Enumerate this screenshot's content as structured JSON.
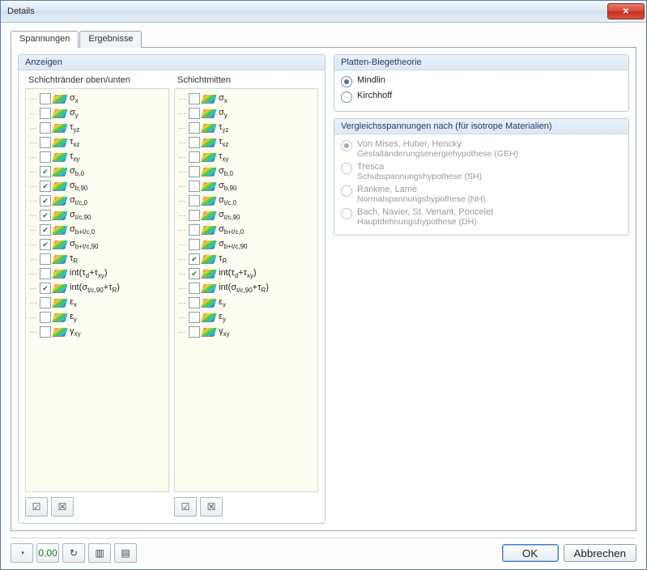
{
  "window": {
    "title": "Details"
  },
  "tabs": [
    {
      "label": "Spannungen",
      "active": true
    },
    {
      "label": "Ergebnisse",
      "active": false
    }
  ],
  "anzeigen": {
    "title": "Anzeigen",
    "col1_header": "Schichtränder oben/unten",
    "col2_header": "Schichtmitten",
    "items_col1": [
      {
        "label": "σ<sub>x</sub>",
        "checked": false
      },
      {
        "label": "σ<sub>y</sub>",
        "checked": false
      },
      {
        "label": "τ<sub>yz</sub>",
        "checked": false
      },
      {
        "label": "τ<sub>xz</sub>",
        "checked": false
      },
      {
        "label": "τ<sub>xy</sub>",
        "checked": false
      },
      {
        "label": "σ<sub>b,0</sub>",
        "checked": true
      },
      {
        "label": "σ<sub>b,90</sub>",
        "checked": true
      },
      {
        "label": "σ<sub>t/c,0</sub>",
        "checked": true
      },
      {
        "label": "σ<sub>t/c,90</sub>",
        "checked": true
      },
      {
        "label": "σ<sub>b+t/c,0</sub>",
        "checked": true
      },
      {
        "label": "σ<sub>b+t/c,90</sub>",
        "checked": true
      },
      {
        "label": "τ<sub>R</sub>",
        "checked": false
      },
      {
        "label": "int(τ<sub>d</sub>+τ<sub>xy</sub>)",
        "checked": false
      },
      {
        "label": "int(σ<sub>t/c,90</sub>+τ<sub>R</sub>)",
        "checked": true
      },
      {
        "label": "ε<sub>x</sub>",
        "checked": false
      },
      {
        "label": "ε<sub>y</sub>",
        "checked": false
      },
      {
        "label": "γ<sub>xy</sub>",
        "checked": false
      }
    ],
    "items_col2": [
      {
        "label": "σ<sub>x</sub>",
        "checked": false
      },
      {
        "label": "σ<sub>y</sub>",
        "checked": false
      },
      {
        "label": "τ<sub>yz</sub>",
        "checked": false
      },
      {
        "label": "τ<sub>xz</sub>",
        "checked": false
      },
      {
        "label": "τ<sub>xy</sub>",
        "checked": false
      },
      {
        "label": "σ<sub>b,0</sub>",
        "checked": false
      },
      {
        "label": "σ<sub>b,90</sub>",
        "checked": false
      },
      {
        "label": "σ<sub>t/c,0</sub>",
        "checked": false
      },
      {
        "label": "σ<sub>t/c,90</sub>",
        "checked": false
      },
      {
        "label": "σ<sub>b+t/c,0</sub>",
        "checked": false
      },
      {
        "label": "σ<sub>b+t/c,90</sub>",
        "checked": false
      },
      {
        "label": "τ<sub>R</sub>",
        "checked": true
      },
      {
        "label": "int(τ<sub>d</sub>+τ<sub>xy</sub>)",
        "checked": true
      },
      {
        "label": "int(σ<sub>t/c,90</sub>+τ<sub>R</sub>)",
        "checked": false
      },
      {
        "label": "ε<sub>x</sub>",
        "checked": false
      },
      {
        "label": "ε<sub>y</sub>",
        "checked": false
      },
      {
        "label": "γ<sub>xy</sub>",
        "checked": false
      }
    ],
    "toolbar": {
      "select_all": "Alle auswählen",
      "select_none": "Keine auswählen"
    }
  },
  "platten": {
    "title": "Platten-Biegetheorie",
    "options": [
      {
        "label": "Mindlin",
        "selected": true
      },
      {
        "label": "Kirchhoff",
        "selected": false
      }
    ]
  },
  "vergleich": {
    "title": "Vergleichsspannungen nach (für isotrope Materialien)",
    "options": [
      {
        "label": "Von Mises, Huber, Hencky",
        "sub": "Gestaltänderungsenergiehypothese (GEH)",
        "selected": true
      },
      {
        "label": "Tresca",
        "sub": "Schubspannungshypothese (SH)",
        "selected": false
      },
      {
        "label": "Rankine, Lamé",
        "sub": "Normalspannungshypothese (NH)",
        "selected": false
      },
      {
        "label": "Bach, Navier, St. Venant, Poncelet",
        "sub": "Hauptdehnungshypothese (DH)",
        "selected": false
      }
    ]
  },
  "bottom_toolbar": {
    "icon1": "help-icon",
    "icon2": "decimals-icon",
    "icon3": "units-icon",
    "icon4": "export-icon",
    "icon5": "layout-icon"
  },
  "buttons": {
    "ok": "OK",
    "cancel": "Abbrechen"
  }
}
